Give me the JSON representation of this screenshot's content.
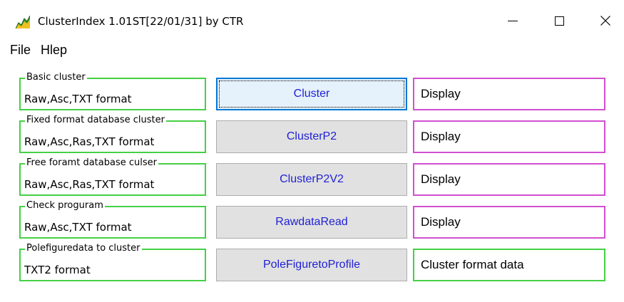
{
  "window": {
    "title": "ClusterIndex 1.01ST[22/01/31] by CTR",
    "icon": "app-chart-icon",
    "controls": [
      "minimize-icon",
      "maximize-icon",
      "close-icon"
    ],
    "close_glyph": "✕"
  },
  "menu": {
    "file": "File",
    "help": "Hlep"
  },
  "rows": [
    {
      "legend": "Basic cluster",
      "format": "Raw,Asc,TXT format",
      "button": "Cluster",
      "display": "Display"
    },
    {
      "legend": "Fixed format database  cluster",
      "format": "Raw,Asc,Ras,TXT format",
      "button": "ClusterP2",
      "display": "Display"
    },
    {
      "legend": "Free foramt database culser",
      "format": "Raw,Asc,Ras,TXT format",
      "button": "ClusterP2V2",
      "display": "Display"
    },
    {
      "legend": "Check proguram",
      "format": "Raw,Asc,TXT format",
      "button": "RawdataRead",
      "display": "Display"
    },
    {
      "legend": "Polefiguredata to cluster",
      "format": "TXT2 format",
      "button": "PoleFiguretoProfile",
      "display": "Cluster format data"
    }
  ],
  "colors": {
    "group_border": "#45d045",
    "display_border": "#d14fd1",
    "button_text": "#1f1fd6",
    "focus_border": "#0078d7"
  }
}
